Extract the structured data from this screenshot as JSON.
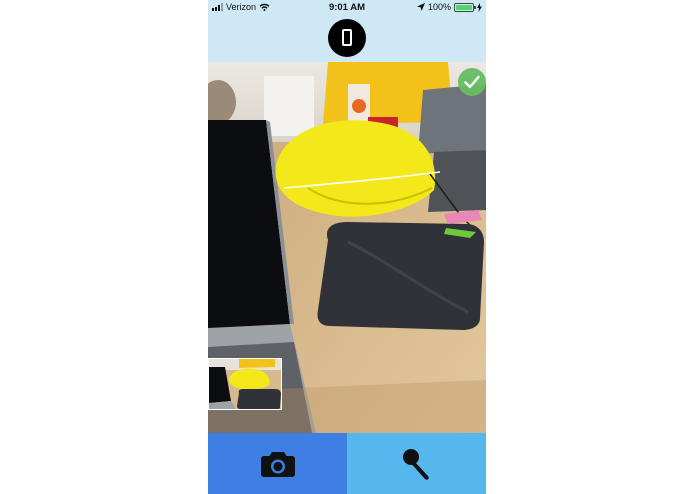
{
  "status_bar": {
    "carrier": "Verizon",
    "time": "9:01 AM",
    "battery": "100%"
  },
  "header": {
    "center_icon": "phone-outline-icon"
  },
  "photo": {
    "status_icon": "checkmark-icon"
  },
  "toolbar": {
    "left_icon": "camera-icon",
    "right_icon": "microphone-icon"
  },
  "colors": {
    "header_bg": "#cfe8f5",
    "camera_button": "#3d7fe2",
    "mic_button": "#56b7ef",
    "check_badge": "#67bd63",
    "battery": "#4cd964"
  }
}
